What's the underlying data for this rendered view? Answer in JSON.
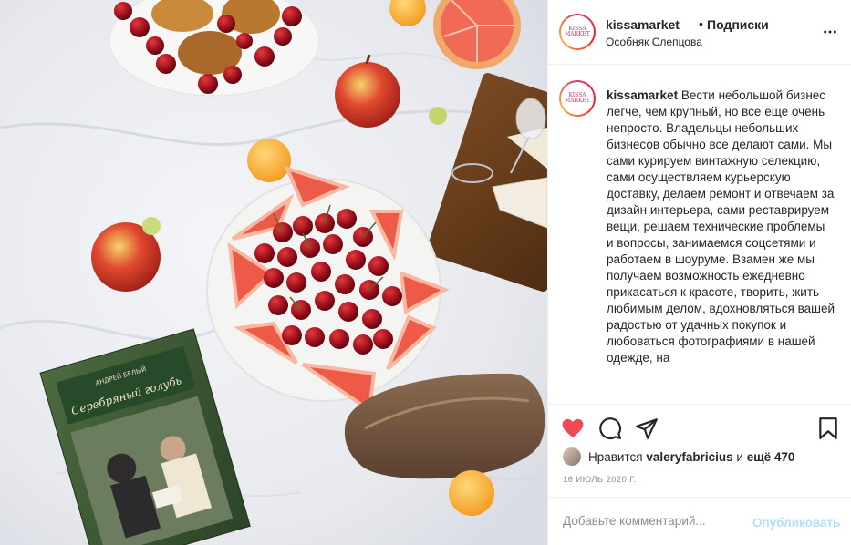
{
  "colors": {
    "accent_blue": "#0095f6",
    "publish_disabled": "#b2dffc",
    "like_red": "#ed4956",
    "secondary_text": "#8e8e8e",
    "divider": "#efefef"
  },
  "post": {
    "image_alt": "Пикник на белой скатерти: черешня с грейпфрутом, хлеб, яблоки, абрикосы и книга",
    "book_author": "АНДРЕЙ БЕЛЫЙ",
    "book_title": "Серебряный голубь",
    "avatar_logo_line1": "KISSA",
    "avatar_logo_line2": "MARKET"
  },
  "header": {
    "username": "kissamarket",
    "separator": "•",
    "follow_label": "Подписки",
    "location": "Особняк Слепцова",
    "more_icon": "more-horizontal-icon"
  },
  "caption": {
    "username": "kissamarket",
    "text": "Вести небольшой бизнес легче, чем крупный, но все еще очень непросто. Владельцы небольших бизнесов обычно все делают сами. Мы сами курируем винтажную селекцию, сами осуществляем курьерскую доставку, делаем ремонт и отвечаем за дизайн интерьера, сами реставрируем вещи, решаем технические проблемы и вопросы, занимаемся соцсетями и работаем в шоуруме. Взамен же мы получаем возможность ежедневно прикасаться к красоте, творить, жить любимым делом, вдохновляться вашей радостью от удачных покупок и любоваться фотографиями в нашей одежде, на"
  },
  "actions": {
    "like_icon": "heart-filled-icon",
    "comment_icon": "comment-icon",
    "share_icon": "share-icon",
    "save_icon": "bookmark-icon"
  },
  "likes": {
    "prefix": "Нравится",
    "user": "valeryfabricius",
    "conjunction": "и",
    "count": "ещё 470"
  },
  "date": "16 ИЮЛЬ 2020 Г.",
  "comment": {
    "placeholder": "Добавьте комментарий...",
    "publish_label": "Опубликовать"
  }
}
